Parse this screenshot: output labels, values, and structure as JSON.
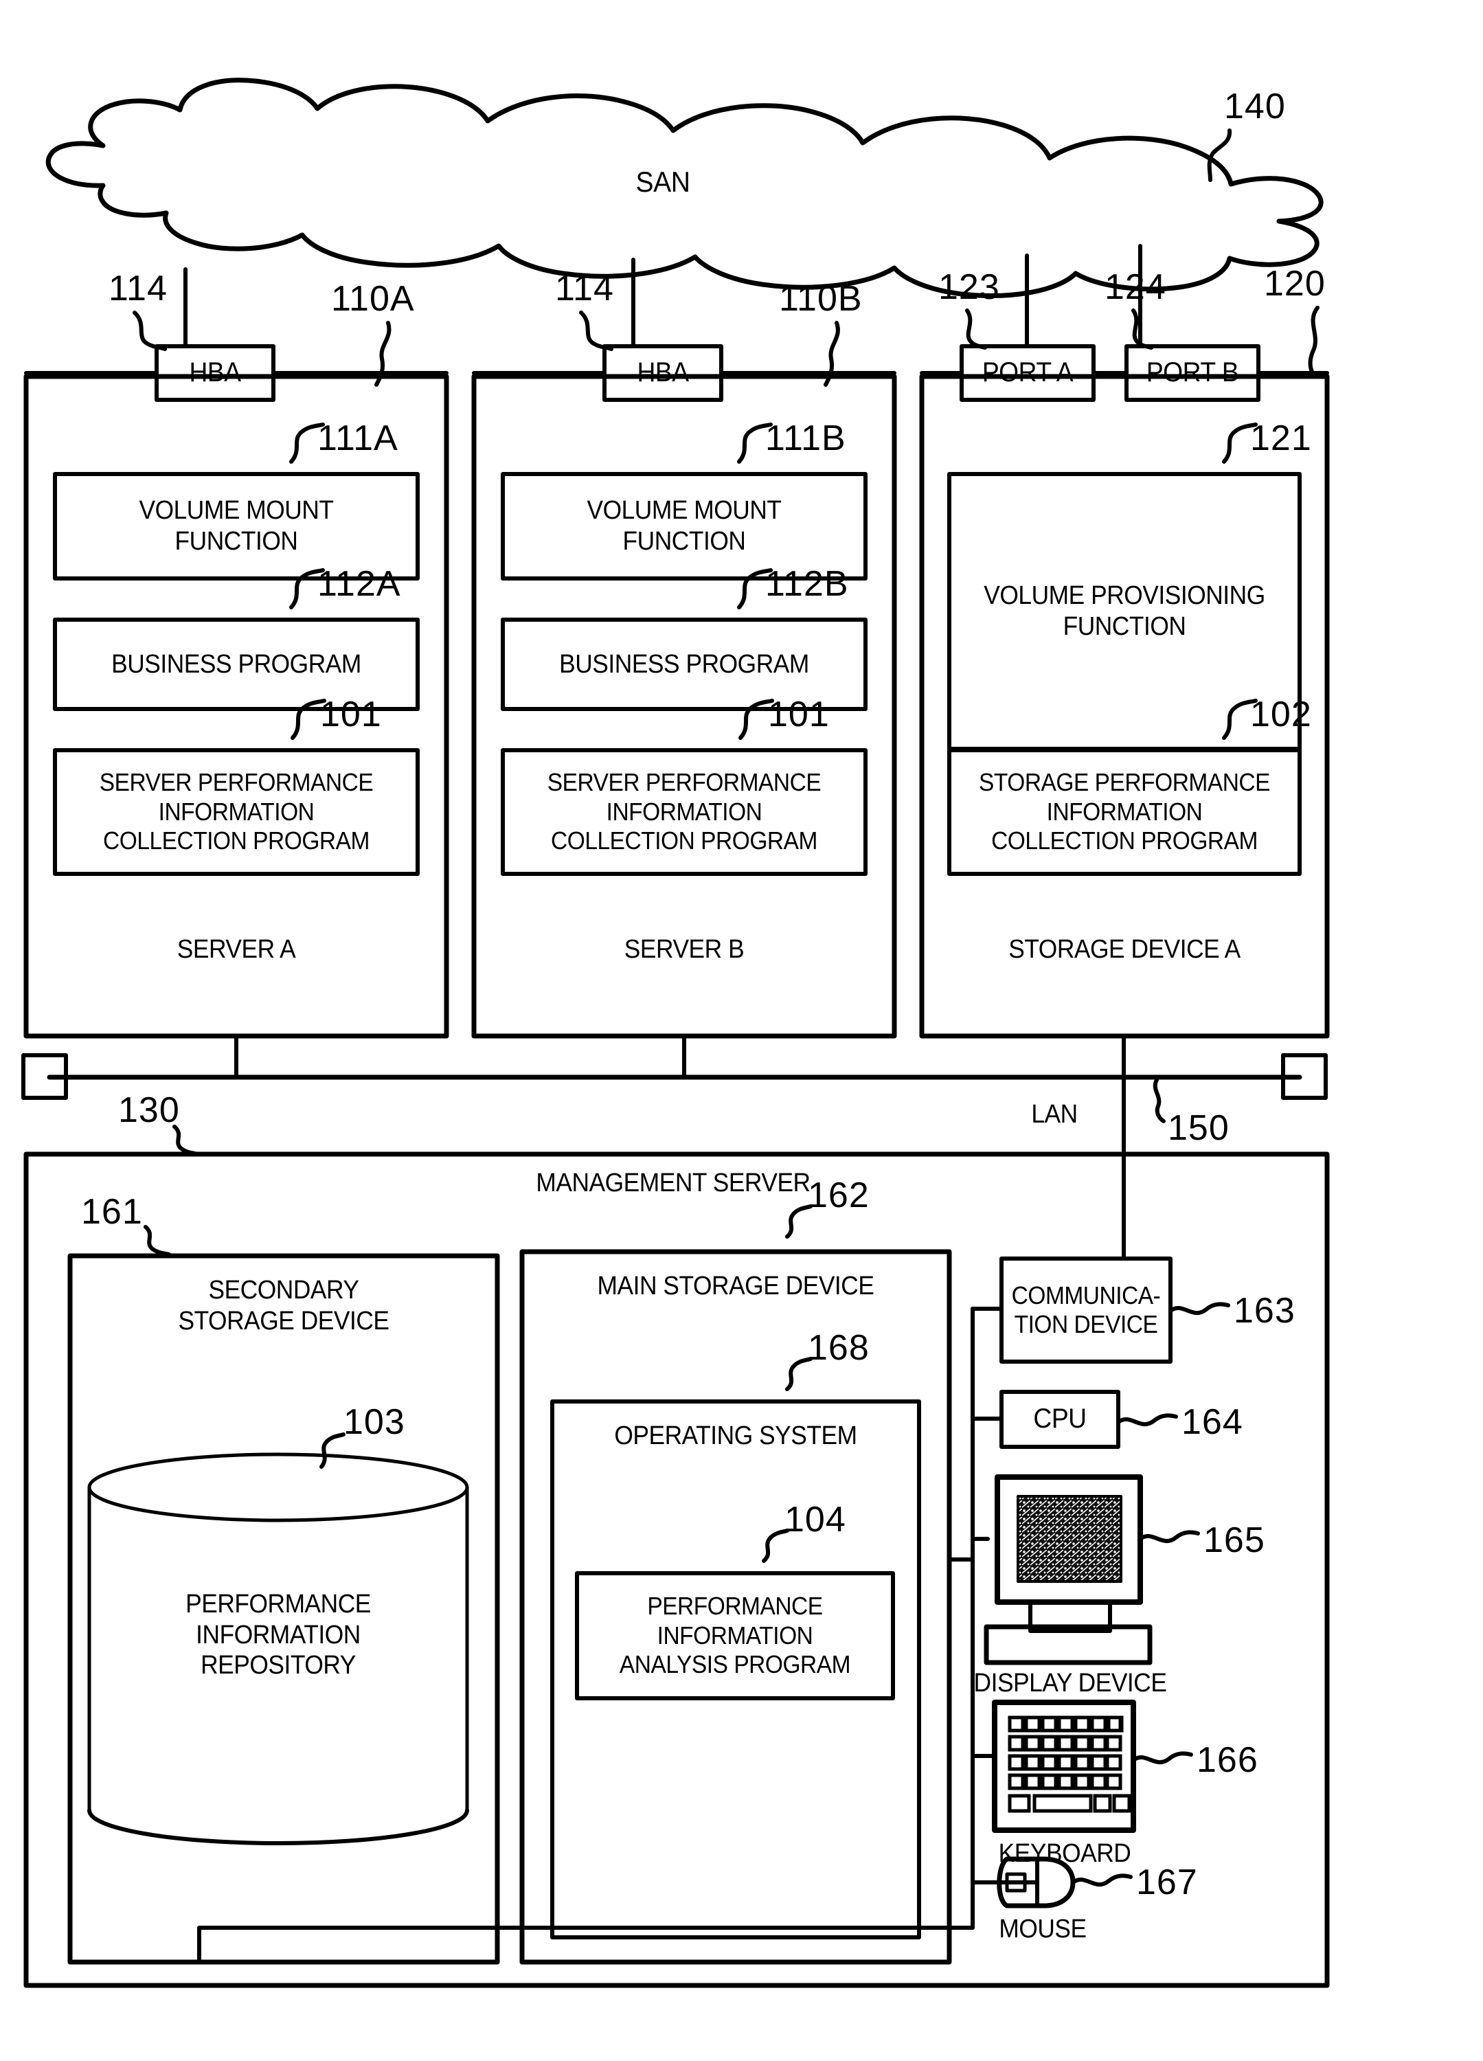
{
  "figure": {
    "network_cloud": {
      "label": "SAN",
      "ref": "140"
    },
    "lan_bus": {
      "label": "LAN",
      "ref": "150"
    }
  },
  "servers": [
    {
      "ref": "110A",
      "title": "SERVER A",
      "hba": {
        "label": "HBA",
        "ref": "114"
      },
      "modules": [
        {
          "ref": "111A",
          "label": "VOLUME MOUNT\nFUNCTION"
        },
        {
          "ref": "112A",
          "label": "BUSINESS PROGRAM"
        },
        {
          "ref": "101",
          "label": "SERVER PERFORMANCE\nINFORMATION\nCOLLECTION PROGRAM"
        }
      ]
    },
    {
      "ref": "110B",
      "title": "SERVER B",
      "hba": {
        "label": "HBA",
        "ref": "114"
      },
      "modules": [
        {
          "ref": "111B",
          "label": "VOLUME MOUNT\nFUNCTION"
        },
        {
          "ref": "112B",
          "label": "BUSINESS PROGRAM"
        },
        {
          "ref": "101",
          "label": "SERVER PERFORMANCE\nINFORMATION\nCOLLECTION PROGRAM"
        }
      ]
    }
  ],
  "storage": {
    "ref": "120",
    "title": "STORAGE DEVICE A",
    "ports": [
      {
        "label": "PORT A",
        "ref": "123"
      },
      {
        "label": "PORT B",
        "ref": "124"
      }
    ],
    "modules": [
      {
        "ref": "121",
        "label": "VOLUME PROVISIONING\nFUNCTION"
      },
      {
        "ref": "102",
        "label": "STORAGE PERFORMANCE\nINFORMATION\nCOLLECTION PROGRAM"
      }
    ]
  },
  "management_server": {
    "ref": "130",
    "title": "MANAGEMENT SERVER",
    "secondary_storage": {
      "ref": "161",
      "label": "SECONDARY\nSTORAGE DEVICE",
      "repository": {
        "ref": "103",
        "label": "PERFORMANCE\nINFORMATION\nREPOSITORY"
      }
    },
    "main_storage": {
      "ref": "162",
      "label": "MAIN STORAGE DEVICE",
      "operating_system": {
        "ref": "168",
        "label": "OPERATING SYSTEM",
        "analysis_program": {
          "ref": "104",
          "label": "PERFORMANCE\nINFORMATION\nANALYSIS PROGRAM"
        }
      }
    },
    "peripherals": [
      {
        "ref": "163",
        "label": "COMMUNICA-\nTION DEVICE",
        "icon": "box"
      },
      {
        "ref": "164",
        "label": "CPU",
        "icon": "box"
      },
      {
        "ref": "165",
        "label": "DISPLAY DEVICE",
        "icon": "monitor-icon"
      },
      {
        "ref": "166",
        "label": "KEYBOARD",
        "icon": "keyboard-icon"
      },
      {
        "ref": "167",
        "label": "MOUSE",
        "icon": "mouse-icon"
      }
    ]
  }
}
